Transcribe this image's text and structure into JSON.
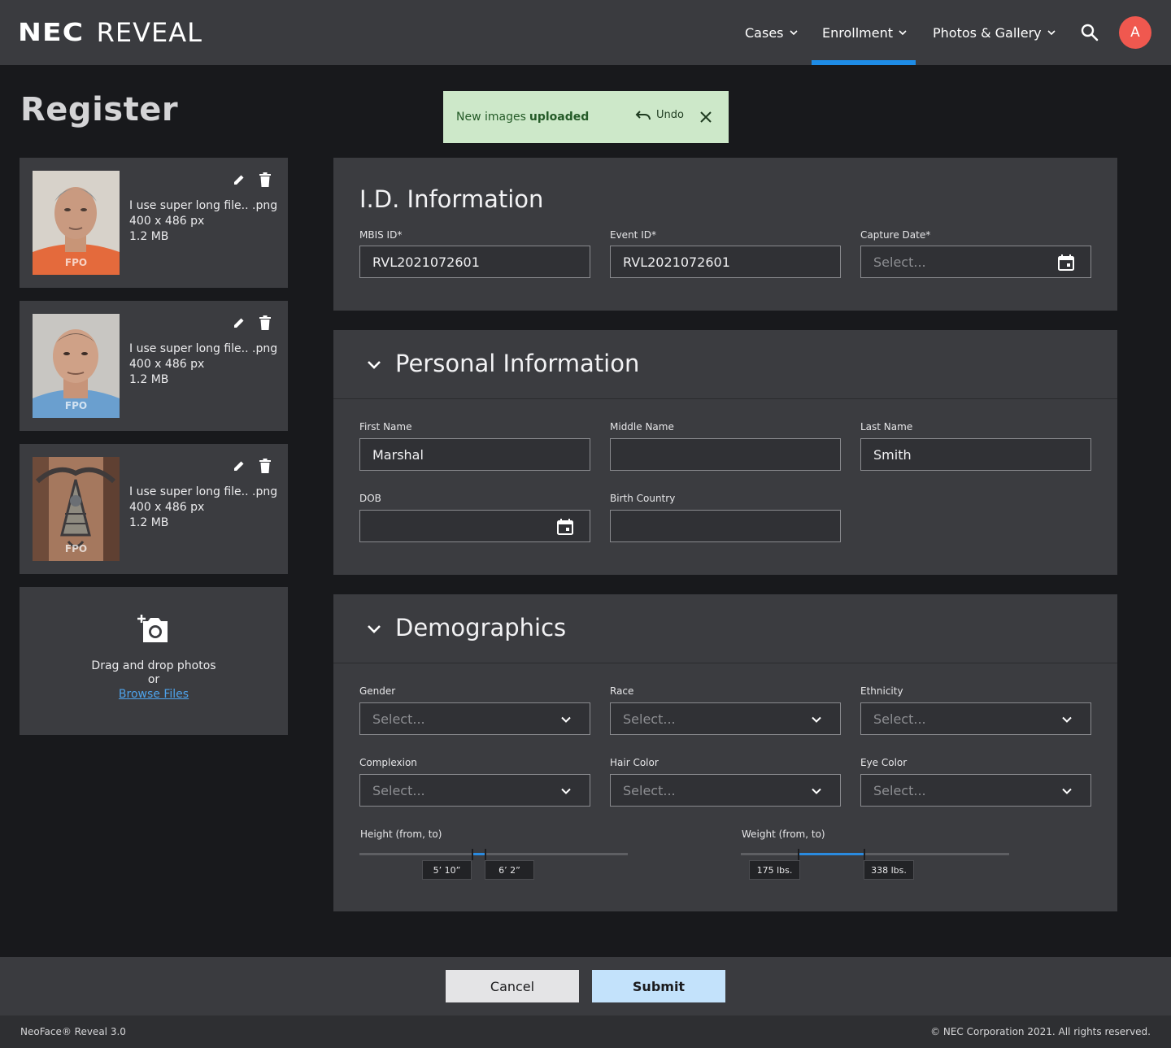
{
  "header": {
    "logo_primary": "NEC",
    "logo_secondary": "REVEAL",
    "nav": [
      "Cases",
      "Enrollment",
      "Photos & Gallery"
    ],
    "active_nav": "Enrollment",
    "avatar_initial": "A",
    "accent_color": "#1e8ce6",
    "avatar_color": "#f0584f"
  },
  "page": {
    "title": "Register"
  },
  "toast": {
    "message_prefix": "New images",
    "message_bold": "uploaded",
    "undo_label": "Undo",
    "color": "#cde8c9"
  },
  "photos": [
    {
      "filename": "I use super long file.. .png",
      "dimensions": "400 x 486 px",
      "size": "1.2 MB",
      "watermark": "FPO"
    },
    {
      "filename": "I use super long file.. .png",
      "dimensions": "400 x 486 px",
      "size": "1.2 MB",
      "watermark": "FPO"
    },
    {
      "filename": "I use super long file.. .png",
      "dimensions": "400 x 486 px",
      "size": "1.2 MB",
      "watermark": "FPO"
    }
  ],
  "dropzone": {
    "text": "Drag and drop photos",
    "or": "or",
    "link": "Browse Files"
  },
  "id_info": {
    "title": "I.D. Information",
    "mbis_label": "MBIS ID*",
    "mbis_value": "RVL2021072601",
    "event_label": "Event ID*",
    "event_value": "RVL2021072601",
    "capture_label": "Capture Date*",
    "capture_placeholder": "Select..."
  },
  "personal": {
    "title": "Personal Information",
    "first_label": "First Name",
    "first_value": "Marshal",
    "middle_label": "Middle Name",
    "middle_value": "",
    "last_label": "Last Name",
    "last_value": "Smith",
    "dob_label": "DOB",
    "dob_value": "",
    "country_label": "Birth Country",
    "country_value": ""
  },
  "demographics": {
    "title": "Demographics",
    "selects": [
      {
        "label": "Gender",
        "value": "Select..."
      },
      {
        "label": "Race",
        "value": "Select..."
      },
      {
        "label": "Ethnicity",
        "value": "Select..."
      },
      {
        "label": "Complexion",
        "value": "Select..."
      },
      {
        "label": "Hair Color",
        "value": "Select..."
      },
      {
        "label": "Eye Color",
        "value": "Select..."
      }
    ],
    "height": {
      "label": "Height (from, to)",
      "from": "5’ 10”",
      "to": "6’ 2”",
      "from_fraction": 0.42,
      "to_fraction": 0.47
    },
    "weight": {
      "label": "Weight (from, to)",
      "from": "175 lbs.",
      "to": "338 lbs.",
      "from_fraction": 0.215,
      "to_fraction": 0.46
    }
  },
  "actions": {
    "cancel": "Cancel",
    "submit": "Submit"
  },
  "footer": {
    "left": "NeoFace® Reveal 3.0",
    "right": "© NEC Corporation 2021. All rights reserved."
  }
}
